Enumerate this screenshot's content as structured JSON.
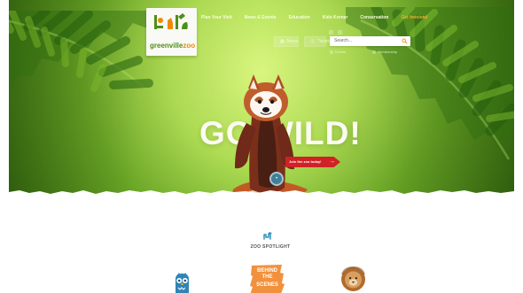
{
  "brand": {
    "logo_text_main": "greenville",
    "logo_text_accent": "zoo",
    "logo_subtext": ""
  },
  "nav": {
    "items": [
      {
        "label": "Plan Your Visit"
      },
      {
        "label": "News & Events"
      },
      {
        "label": "Education"
      },
      {
        "label": "Kids Korner"
      },
      {
        "label": "Conservation"
      },
      {
        "label": "Get Involved"
      }
    ]
  },
  "utility": {
    "news_label": "News",
    "tickets_label": "Tickets",
    "search_placeholder": "Search...",
    "quick_links": [
      {
        "label": "Events"
      },
      {
        "label": "Membership"
      }
    ]
  },
  "hero": {
    "headline": "GO WILD!",
    "cta_label": "Join the zoo today!",
    "cta_arrow": "→"
  },
  "spotlight": {
    "label": "ZOO SPOTLIGHT",
    "behind_lines": [
      "BEHIND",
      "THE",
      "SCENES"
    ]
  },
  "colors": {
    "green_bright": "#a6dd43",
    "green_dark": "#4d8f14",
    "brand_orange": "#f18a00",
    "cta_red": "#cf2126",
    "owl_blue": "#2e84b7",
    "teaser_orange": "#f2913d"
  },
  "icons": {
    "search": "search-icon",
    "news": "newspaper-icon",
    "tickets": "ticket-icon",
    "badge": "info-icon",
    "owl": "owl-icon",
    "lion": "lion-icon",
    "spotlight": "giraffe-icon"
  }
}
